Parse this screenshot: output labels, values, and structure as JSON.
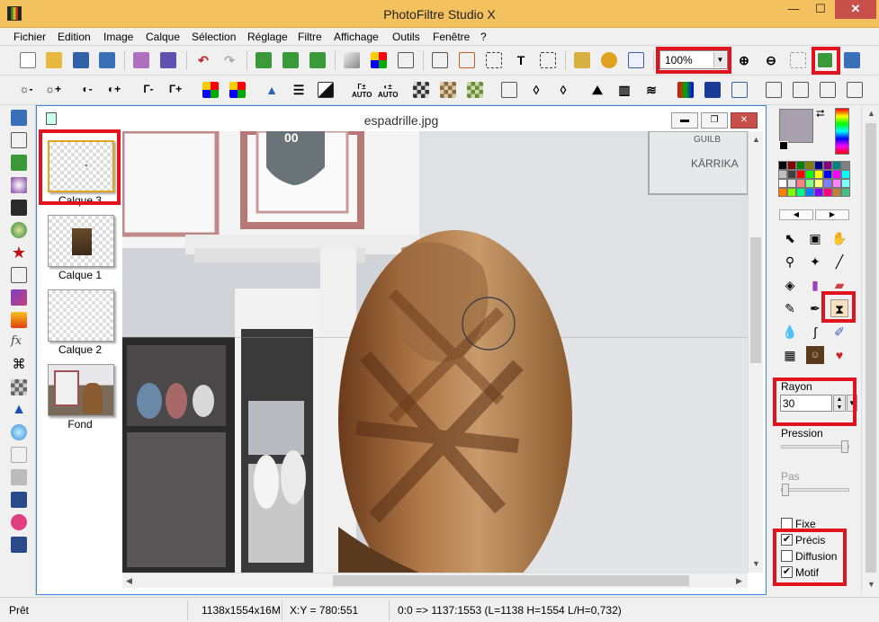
{
  "window": {
    "title": "PhotoFiltre Studio X",
    "min": "—",
    "max": "☐",
    "close": "✕"
  },
  "menu": [
    "Fichier",
    "Edition",
    "Image",
    "Calque",
    "Sélection",
    "Réglage",
    "Filtre",
    "Affichage",
    "Outils",
    "Fenêtre",
    "?"
  ],
  "toolbar": {
    "zoom_value": "100%",
    "text_tool": "T",
    "icons": [
      "new-file-icon",
      "open-folder-icon",
      "save-icon",
      "save-as-icon",
      "print-icon",
      "scan-icon",
      "undo-icon",
      "redo-icon",
      "layer-up-icon",
      "layer-down-icon",
      "layer-merge-icon",
      "gradient-icon",
      "color-grid-icon",
      "transform-icon",
      "crop-portrait-icon",
      "crop-landscape-icon",
      "selection-icon",
      "text-icon",
      "resize-icon",
      "layer-tree-icon",
      "puzzle-icon",
      "window-icon",
      "zoom-in-icon",
      "zoom-out-icon",
      "fit-icon",
      "fullscreen-image-icon",
      "slideshow-icon"
    ]
  },
  "toolbar2": {
    "auto1": "Γ± AUTO",
    "auto2": "◐± AUTO"
  },
  "document": {
    "title": "espadrille.jpg",
    "min": "▬",
    "restore": "❐",
    "close": "✕"
  },
  "layers": [
    {
      "label": "Calque 3",
      "selected": true
    },
    {
      "label": "Calque 1",
      "selected": false
    },
    {
      "label": "Calque 2",
      "selected": false
    },
    {
      "label": "Fond",
      "selected": false
    }
  ],
  "right_panel": {
    "fg_color": "#a8a1ad",
    "swap": "⮂",
    "rayon_label": "Rayon",
    "rayon_value": "30",
    "pression_label": "Pression",
    "pression_value": 1.0,
    "pas_label": "Pas",
    "pas_value": 0.0,
    "fixe_label": "Fixe",
    "precis_label": "Précis",
    "diffusion_label": "Diffusion",
    "motif_label": "Motif",
    "fixe_checked": false,
    "precis_checked": true,
    "diffusion_checked": false,
    "motif_checked": true,
    "check_mark": "✔",
    "nav_left": "◀",
    "nav_right": "▶",
    "palette": [
      "#000000",
      "#800000",
      "#008000",
      "#808000",
      "#000080",
      "#800080",
      "#008080",
      "#808080",
      "#c0c0c0",
      "#404040",
      "#ff0000",
      "#00ff00",
      "#ffff00",
      "#0000ff",
      "#ff00ff",
      "#00ffff",
      "#ffffff",
      "#e0e0e0",
      "#ff8080",
      "#80ff80",
      "#ffff80",
      "#8080ff",
      "#ff80ff",
      "#80ffff",
      "#ff8000",
      "#80ff00",
      "#00ff80",
      "#0080ff",
      "#8000ff",
      "#ff0080",
      "#c08040",
      "#40c080"
    ]
  },
  "status": {
    "ready": "Prêt",
    "dimensions": "1138x1554x16M",
    "xy": "X:Y = 780:551",
    "selection": "0:0 => 1137:1553 (L=1138  H=1554  L/H=0,732)"
  }
}
